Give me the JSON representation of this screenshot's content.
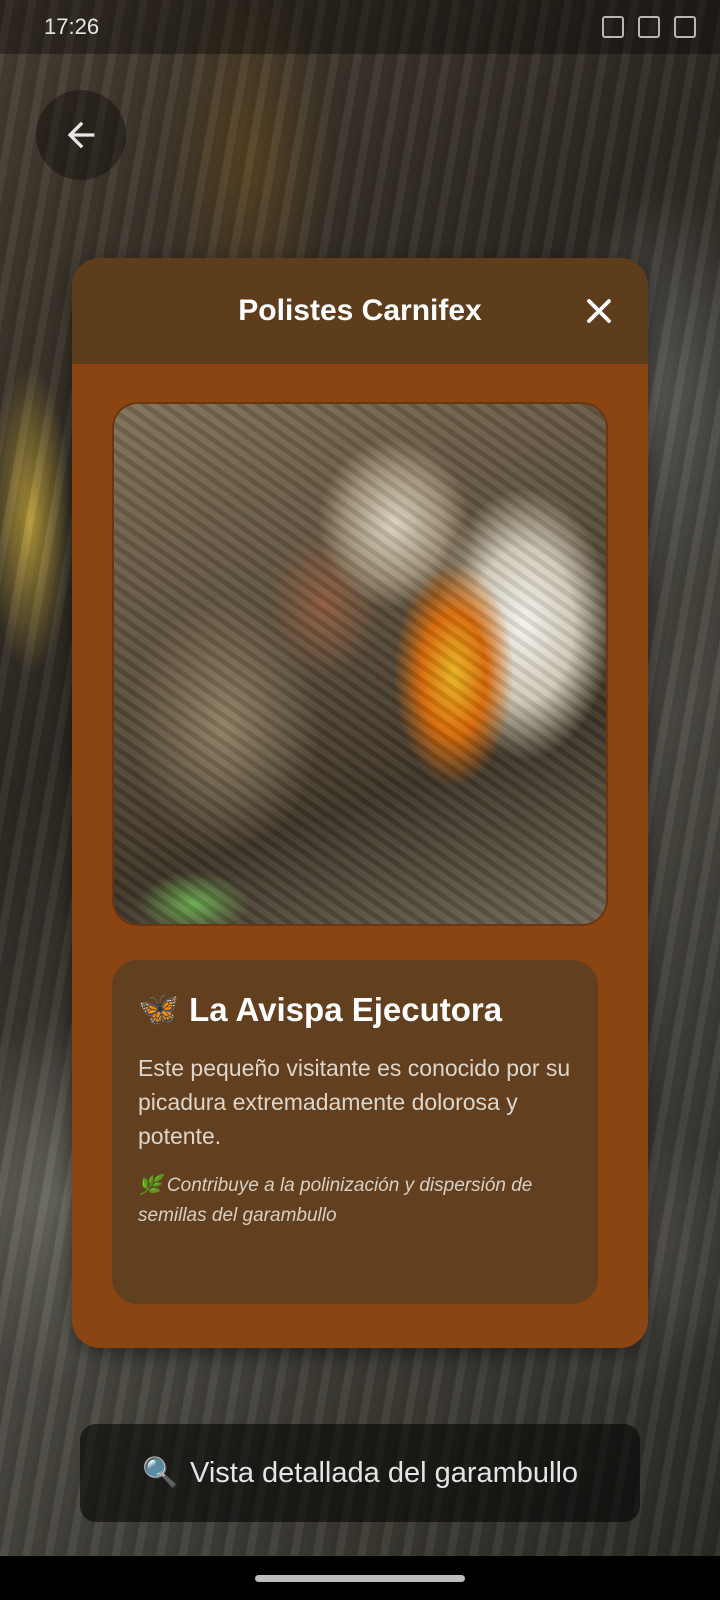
{
  "status_bar": {
    "time": "17:26"
  },
  "modal": {
    "title": "Polistes Carnifex",
    "card": {
      "emoji": "🦋",
      "heading": "La Avispa Ejecutora",
      "body": "Este pequeño visitante es conocido por su picadura extremadamente dolorosa y potente.",
      "note": "🌿 Contribuye a la polinización y dispersión de semillas del garambullo"
    }
  },
  "banner": {
    "icon": "🔍",
    "text": "Vista detallada del garambullo"
  },
  "colors": {
    "modal_bg": "#8b4513",
    "modal_header": "#5e3d1d",
    "card_bg": "#62401f"
  },
  "icons": [
    "back-arrow-icon",
    "close-icon",
    "search-icon",
    "butterfly-icon",
    "leaf-icon"
  ]
}
